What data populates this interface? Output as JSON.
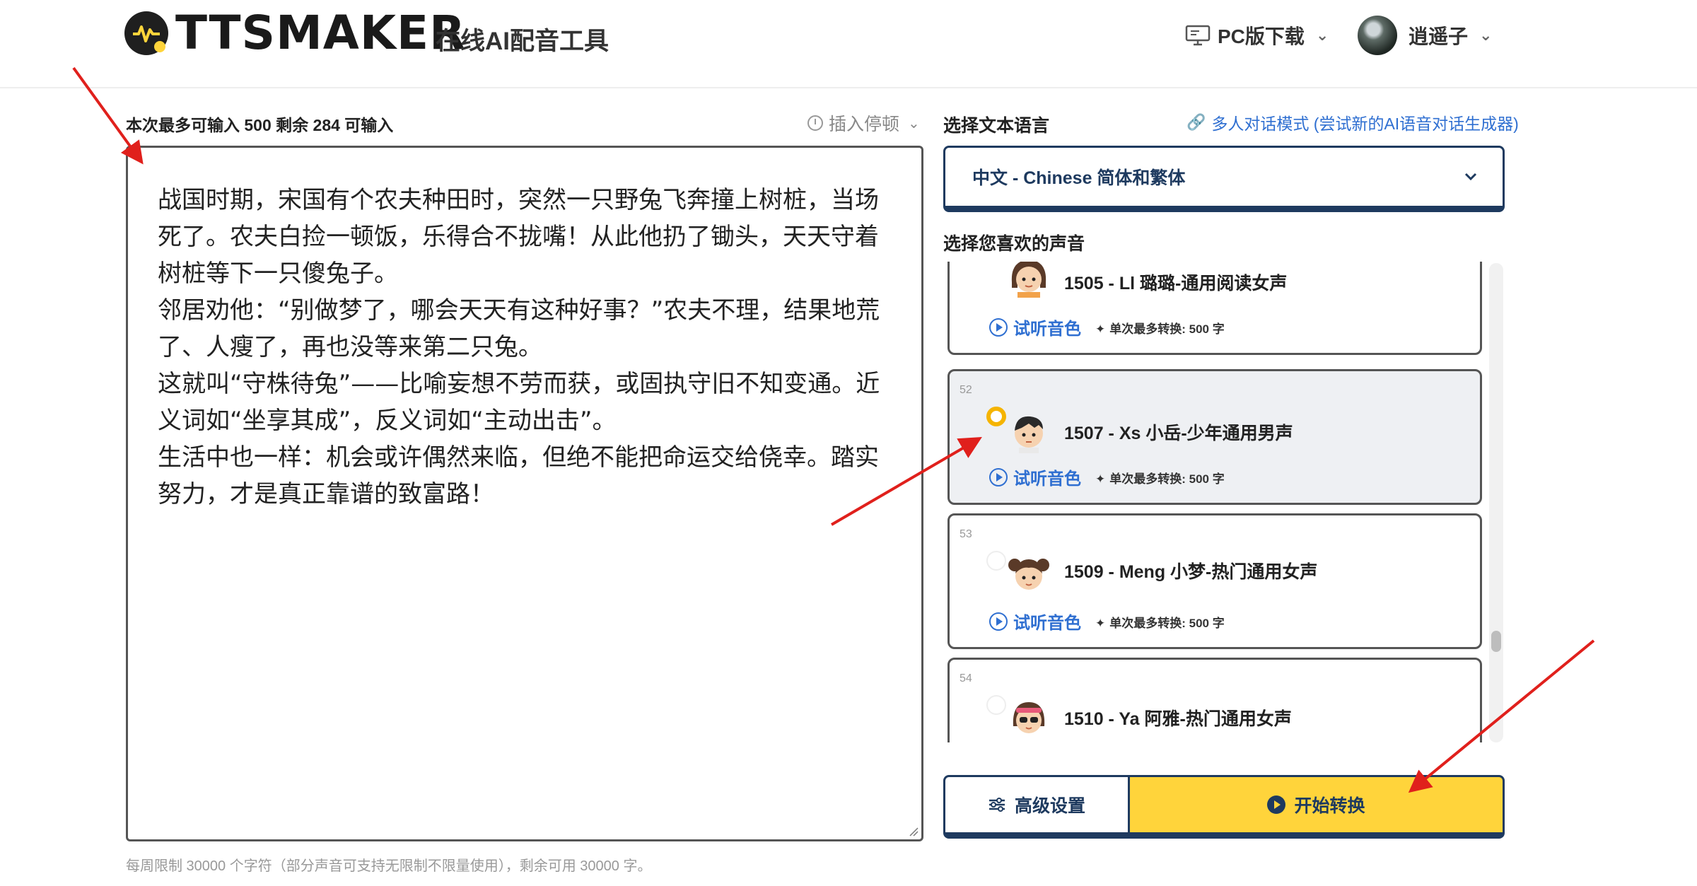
{
  "header": {
    "logo_text": "TTSMAKER",
    "subtitle": "在线AI配音工具",
    "pc_download": "PC版下载",
    "username": "逍遥子"
  },
  "editor": {
    "counter": "本次最多可输入 500 剩余 284 可输入",
    "insert_pause": "插入停顿",
    "text": "战国时期，宋国有个农夫种田时，突然一只野兔飞奔撞上树桩，当场死了。农夫白捡一顿饭，乐得合不拢嘴！从此他扔了锄头，天天守着树桩等下一只傻兔子。\n邻居劝他：“别做梦了，哪会天天有这种好事？”农夫不理，结果地荒了、人瘦了，再也没等来第二只兔。\n这就叫“守株待兔”——比喻妄想不劳而获，或固执守旧不知变通。近义词如“坐享其成”，反义词如“主动出击”。\n生活中也一样：机会或许偶然来临，但绝不能把命运交给侥幸。踏实努力，才是真正靠谱的致富路！",
    "weekly_limit": "每周限制 30000 个字符（部分声音可支持无限制不限量使用），剩余可用 30000 字。"
  },
  "language": {
    "label": "选择文本语言",
    "multi_mode_link": "多人对话模式 (尝试新的AI语音对话生成器)",
    "selected": "中文 - Chinese 简体和繁体"
  },
  "voices": {
    "label": "选择您喜欢的声音",
    "preview_label": "试听音色",
    "max_convert": "单次最多转换: 500 字",
    "items": [
      {
        "index": "",
        "name": "1505 - Ll 璐璐-通用阅读女声",
        "selected": false
      },
      {
        "index": "52",
        "name": "1507 - Xs 小岳-少年通用男声",
        "selected": true
      },
      {
        "index": "53",
        "name": "1509 - Meng 小梦-热门通用女声",
        "selected": false
      },
      {
        "index": "54",
        "name": "1510 - Ya 阿雅-热门通用女声",
        "selected": false
      }
    ]
  },
  "actions": {
    "advanced": "高级设置",
    "start": "开始转换"
  },
  "colors": {
    "accent_yellow": "#ffd43b",
    "navy": "#1e3a5f",
    "link_blue": "#2f6fd1",
    "annotation_red": "#e0201c"
  }
}
